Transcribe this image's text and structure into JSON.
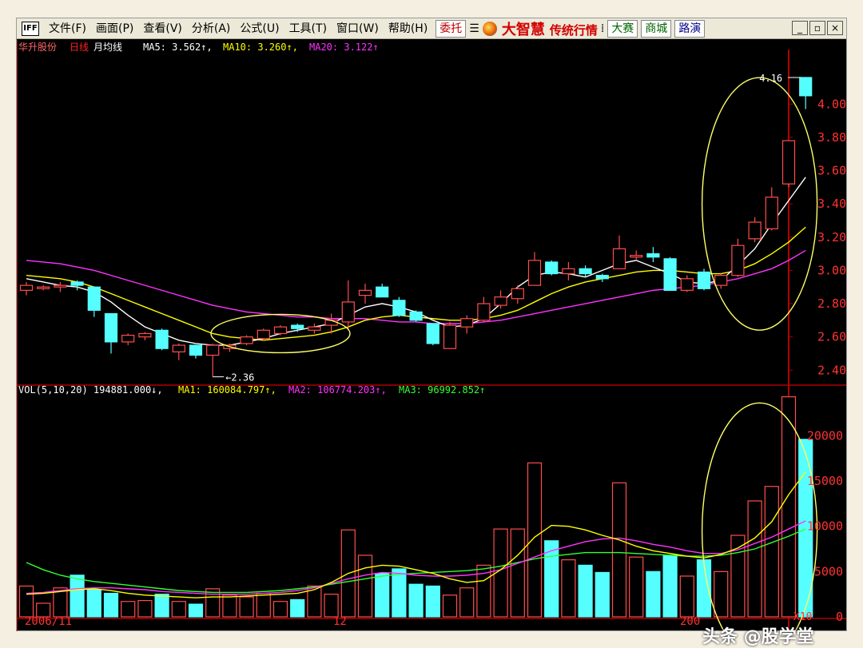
{
  "menu": {
    "app_icon": "IFF",
    "items": [
      "文件(F)",
      "画面(P)",
      "查看(V)",
      "分析(A)",
      "公式(U)",
      "工具(T)",
      "窗口(W)",
      "帮助(H)"
    ],
    "entrust": "委托",
    "brand": "大智慧",
    "brand_sub": "传统行情",
    "contest": "大赛",
    "mall": "商城",
    "roadshow": "路演",
    "minimize": "_",
    "restore": "▫",
    "close": "×"
  },
  "price_header": {
    "stock": "华升股份",
    "period": "日线",
    "ma_title": "月均线",
    "ma5": "MA5: 3.562↑,",
    "ma10": "MA10: 3.260↑,",
    "ma20": "MA20: 3.122↑"
  },
  "vol_header": {
    "label": "VOL(5,10,20) 194881.000↓,",
    "ma1": "MA1: 160084.797↑,",
    "ma2": "MA2: 106774.203↑,",
    "ma3": "MA3: 96992.852↑"
  },
  "annotations": {
    "high": "4.16",
    "low": "2.36"
  },
  "x_labels": {
    "start": "2006/11",
    "mid": "12",
    "end": "200"
  },
  "vol_unit": "X10",
  "watermark": "头条 @股学堂",
  "colors": {
    "up": "#ff4d4d",
    "down": "#55ffff",
    "ma5": "#ffffff",
    "ma10": "#ffff00",
    "ma20": "#ff33ff",
    "vma3": "#33ff33",
    "axis": "#b00000",
    "ellipse": "#ffff66"
  },
  "chart_data": {
    "type": "candlestick",
    "price_ticks": [
      "4.00",
      "3.80",
      "3.60",
      "3.40",
      "3.20",
      "3.00",
      "2.80",
      "2.60",
      "2.40"
    ],
    "price_range": [
      2.31,
      4.28
    ],
    "volume_ticks": [
      "20000",
      "15000",
      "10000",
      "5000",
      "0"
    ],
    "volume_range": [
      0,
      24000
    ],
    "candles": [
      {
        "o": 2.88,
        "c": 2.91,
        "h": 2.93,
        "l": 2.85,
        "v": 3400
      },
      {
        "o": 2.9,
        "c": 2.9,
        "h": 2.91,
        "l": 2.88,
        "v": 1500
      },
      {
        "o": 2.9,
        "c": 2.91,
        "h": 2.93,
        "l": 2.87,
        "v": 3200
      },
      {
        "o": 2.93,
        "c": 2.91,
        "h": 2.94,
        "l": 2.88,
        "v": 4600
      },
      {
        "o": 2.9,
        "c": 2.76,
        "h": 2.9,
        "l": 2.72,
        "v": 3000
      },
      {
        "o": 2.74,
        "c": 2.57,
        "h": 2.74,
        "l": 2.5,
        "v": 2600
      },
      {
        "o": 2.57,
        "c": 2.61,
        "h": 2.62,
        "l": 2.55,
        "v": 1700
      },
      {
        "o": 2.6,
        "c": 2.62,
        "h": 2.63,
        "l": 2.58,
        "v": 1800
      },
      {
        "o": 2.64,
        "c": 2.53,
        "h": 2.65,
        "l": 2.52,
        "v": 2500
      },
      {
        "o": 2.51,
        "c": 2.55,
        "h": 2.56,
        "l": 2.46,
        "v": 1700
      },
      {
        "o": 2.55,
        "c": 2.49,
        "h": 2.55,
        "l": 2.47,
        "v": 1400
      },
      {
        "o": 2.49,
        "c": 2.55,
        "h": 2.56,
        "l": 2.36,
        "v": 3100
      },
      {
        "o": 2.53,
        "c": 2.55,
        "h": 2.56,
        "l": 2.51,
        "v": 2400
      },
      {
        "o": 2.56,
        "c": 2.6,
        "h": 2.61,
        "l": 2.55,
        "v": 2200
      },
      {
        "o": 2.59,
        "c": 2.64,
        "h": 2.65,
        "l": 2.58,
        "v": 2600
      },
      {
        "o": 2.62,
        "c": 2.66,
        "h": 2.67,
        "l": 2.61,
        "v": 1700
      },
      {
        "o": 2.67,
        "c": 2.65,
        "h": 2.68,
        "l": 2.63,
        "v": 1900
      },
      {
        "o": 2.64,
        "c": 2.66,
        "h": 2.68,
        "l": 2.62,
        "v": 3400
      },
      {
        "o": 2.67,
        "c": 2.7,
        "h": 2.74,
        "l": 2.62,
        "v": 2500
      },
      {
        "o": 2.69,
        "c": 2.81,
        "h": 2.94,
        "l": 2.64,
        "v": 9600
      },
      {
        "o": 2.85,
        "c": 2.88,
        "h": 2.92,
        "l": 2.8,
        "v": 6800
      },
      {
        "o": 2.9,
        "c": 2.84,
        "h": 2.92,
        "l": 2.84,
        "v": 4800
      },
      {
        "o": 2.82,
        "c": 2.73,
        "h": 2.84,
        "l": 2.72,
        "v": 5300
      },
      {
        "o": 2.75,
        "c": 2.7,
        "h": 2.76,
        "l": 2.69,
        "v": 3600
      },
      {
        "o": 2.68,
        "c": 2.56,
        "h": 2.68,
        "l": 2.55,
        "v": 3400
      },
      {
        "o": 2.53,
        "c": 2.67,
        "h": 2.69,
        "l": 2.53,
        "v": 2400
      },
      {
        "o": 2.66,
        "c": 2.71,
        "h": 2.73,
        "l": 2.62,
        "v": 3200
      },
      {
        "o": 2.7,
        "c": 2.8,
        "h": 2.84,
        "l": 2.69,
        "v": 5700
      },
      {
        "o": 2.79,
        "c": 2.84,
        "h": 2.88,
        "l": 2.77,
        "v": 9700
      },
      {
        "o": 2.83,
        "c": 2.89,
        "h": 2.91,
        "l": 2.8,
        "v": 9700
      },
      {
        "o": 2.91,
        "c": 3.06,
        "h": 3.11,
        "l": 2.91,
        "v": 17000
      },
      {
        "o": 3.05,
        "c": 2.98,
        "h": 3.06,
        "l": 2.97,
        "v": 8400
      },
      {
        "o": 2.98,
        "c": 3.01,
        "h": 3.05,
        "l": 2.94,
        "v": 6300
      },
      {
        "o": 3.01,
        "c": 2.98,
        "h": 3.03,
        "l": 2.96,
        "v": 5700
      },
      {
        "o": 2.97,
        "c": 2.95,
        "h": 2.98,
        "l": 2.93,
        "v": 4900
      },
      {
        "o": 3.01,
        "c": 3.13,
        "h": 3.21,
        "l": 3.01,
        "v": 14800
      },
      {
        "o": 3.08,
        "c": 3.09,
        "h": 3.12,
        "l": 3.06,
        "v": 6600
      },
      {
        "o": 3.1,
        "c": 3.08,
        "h": 3.14,
        "l": 3.05,
        "v": 5000
      },
      {
        "o": 3.07,
        "c": 2.88,
        "h": 3.08,
        "l": 2.88,
        "v": 6800
      },
      {
        "o": 2.88,
        "c": 2.95,
        "h": 2.97,
        "l": 2.87,
        "v": 4500
      },
      {
        "o": 2.99,
        "c": 2.89,
        "h": 3.01,
        "l": 2.88,
        "v": 6300
      },
      {
        "o": 2.91,
        "c": 2.97,
        "h": 2.98,
        "l": 2.89,
        "v": 5000
      },
      {
        "o": 2.97,
        "c": 3.15,
        "h": 3.19,
        "l": 2.96,
        "v": 9000
      },
      {
        "o": 3.19,
        "c": 3.29,
        "h": 3.32,
        "l": 3.17,
        "v": 12800
      },
      {
        "o": 3.25,
        "c": 3.44,
        "h": 3.5,
        "l": 3.24,
        "v": 14400
      },
      {
        "o": 3.52,
        "c": 3.78,
        "h": 3.78,
        "l": 3.5,
        "v": 24300
      },
      {
        "o": 4.16,
        "c": 4.05,
        "h": 4.16,
        "l": 3.97,
        "v": 19600
      }
    ],
    "ma5": [
      2.95,
      2.93,
      2.91,
      2.9,
      2.87,
      2.81,
      2.73,
      2.66,
      2.62,
      2.58,
      2.56,
      2.55,
      2.55,
      2.57,
      2.59,
      2.62,
      2.64,
      2.66,
      2.68,
      2.73,
      2.78,
      2.8,
      2.78,
      2.75,
      2.7,
      2.66,
      2.67,
      2.71,
      2.8,
      2.9,
      2.97,
      2.99,
      2.98,
      2.96,
      3.0,
      3.04,
      3.06,
      3.02,
      2.98,
      2.93,
      2.92,
      2.94,
      3.03,
      3.13,
      3.28,
      3.42,
      3.56
    ],
    "ma10": [
      2.97,
      2.96,
      2.95,
      2.93,
      2.9,
      2.86,
      2.82,
      2.78,
      2.74,
      2.7,
      2.66,
      2.62,
      2.6,
      2.59,
      2.58,
      2.59,
      2.6,
      2.61,
      2.63,
      2.66,
      2.7,
      2.72,
      2.73,
      2.72,
      2.71,
      2.7,
      2.7,
      2.71,
      2.73,
      2.76,
      2.81,
      2.86,
      2.9,
      2.93,
      2.95,
      2.97,
      2.99,
      3.0,
      3.0,
      2.99,
      2.98,
      2.98,
      3.0,
      3.04,
      3.1,
      3.17,
      3.26
    ],
    "ma20": [
      3.06,
      3.05,
      3.04,
      3.02,
      3.0,
      2.97,
      2.94,
      2.91,
      2.88,
      2.85,
      2.82,
      2.79,
      2.77,
      2.75,
      2.74,
      2.73,
      2.72,
      2.72,
      2.71,
      2.71,
      2.71,
      2.7,
      2.69,
      2.69,
      2.68,
      2.68,
      2.68,
      2.69,
      2.7,
      2.72,
      2.74,
      2.76,
      2.78,
      2.8,
      2.82,
      2.84,
      2.86,
      2.88,
      2.89,
      2.9,
      2.91,
      2.93,
      2.95,
      2.98,
      3.01,
      3.06,
      3.12
    ],
    "vma1": [
      2500,
      2600,
      2800,
      3000,
      3100,
      2900,
      2600,
      2400,
      2300,
      2200,
      2100,
      2200,
      2200,
      2300,
      2400,
      2500,
      2600,
      3000,
      3800,
      4800,
      5400,
      5700,
      5600,
      5200,
      4800,
      4200,
      3800,
      4000,
      5200,
      6800,
      8800,
      10100,
      10000,
      9600,
      9000,
      8500,
      7800,
      7300,
      7000,
      6700,
      6500,
      6900,
      7600,
      8700,
      10500,
      13500,
      16000
    ],
    "vma2": [
      2600,
      2700,
      2900,
      3100,
      3200,
      3200,
      3100,
      3000,
      2800,
      2700,
      2600,
      2500,
      2500,
      2500,
      2600,
      2700,
      2900,
      3200,
      3700,
      4200,
      4600,
      4900,
      4800,
      4600,
      4500,
      4500,
      4600,
      4800,
      5200,
      5900,
      6600,
      7300,
      7800,
      8300,
      8600,
      8700,
      8400,
      8000,
      7700,
      7300,
      7000,
      7000,
      7400,
      8100,
      8800,
      9700,
      10600
    ],
    "vma3": [
      6000,
      5200,
      4600,
      4200,
      3900,
      3700,
      3500,
      3300,
      3100,
      2900,
      2800,
      2700,
      2700,
      2700,
      2800,
      2900,
      3100,
      3300,
      3600,
      3900,
      4200,
      4500,
      4700,
      4800,
      4900,
      5000,
      5100,
      5300,
      5600,
      6000,
      6400,
      6700,
      6900,
      7100,
      7100,
      7100,
      7000,
      6900,
      6800,
      6700,
      6700,
      6800,
      7100,
      7500,
      8200,
      8900,
      9700
    ]
  }
}
